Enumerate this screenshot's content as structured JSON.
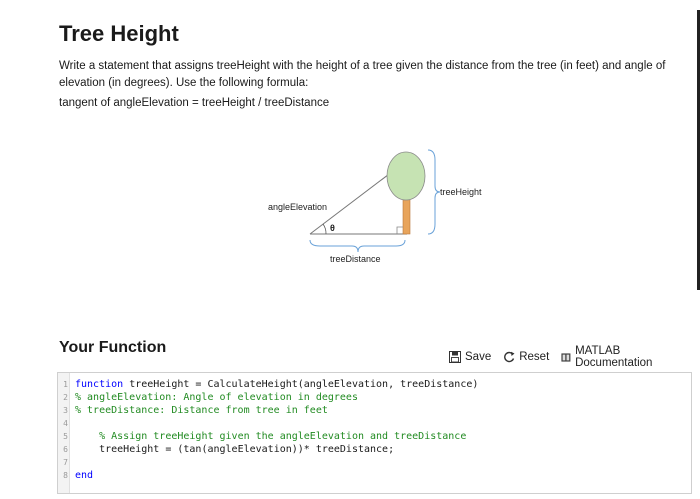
{
  "header": {
    "title": "Tree Height",
    "description": "Write a statement that assigns treeHeight with the height of a tree given the distance from the tree (in feet) and angle of elevation (in degrees). Use the following formula:",
    "formula": "tangent of angleElevation = treeHeight / treeDistance"
  },
  "diagram": {
    "angle_label": "angleElevation",
    "theta": "θ",
    "height_label": "treeHeight",
    "distance_label": "treeDistance"
  },
  "function_section": {
    "title": "Your Function",
    "save_label": "Save",
    "reset_label": "Reset",
    "docs_label": "MATLAB Documentation"
  },
  "editor": {
    "lines": [
      {
        "n": "1",
        "kw": "function",
        "rest": " treeHeight = CalculateHeight(angleElevation, treeDistance)",
        "indent": "",
        "comment": ""
      },
      {
        "n": "2",
        "kw": "",
        "rest": "",
        "indent": "",
        "comment": "% angleElevation: Angle of elevation in degrees"
      },
      {
        "n": "3",
        "kw": "",
        "rest": "",
        "indent": "",
        "comment": "% treeDistance: Distance from tree in feet"
      },
      {
        "n": "4",
        "kw": "",
        "rest": "",
        "indent": "",
        "comment": ""
      },
      {
        "n": "5",
        "kw": "",
        "rest": "",
        "indent": "    ",
        "comment": "% Assign treeHeight given the angleElevation and treeDistance"
      },
      {
        "n": "6",
        "kw": "",
        "rest": "treeHeight = (tan(angleElevation))* treeDistance;",
        "indent": "    ",
        "comment": ""
      },
      {
        "n": "7",
        "kw": "",
        "rest": "",
        "indent": "",
        "comment": ""
      },
      {
        "n": "8",
        "kw": "end",
        "rest": "",
        "indent": "",
        "comment": ""
      }
    ]
  }
}
